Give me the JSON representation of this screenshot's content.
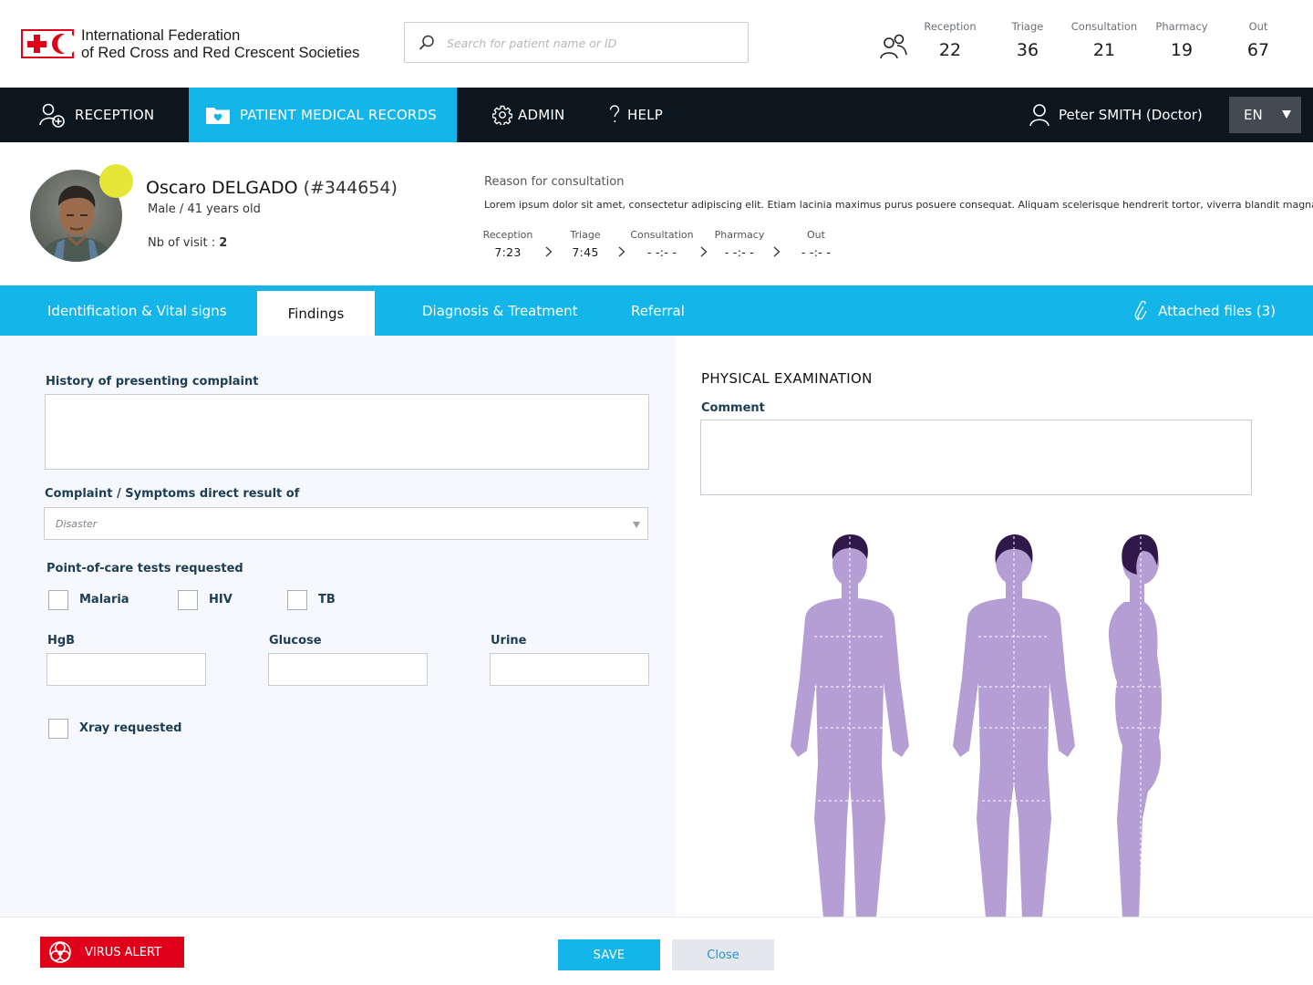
{
  "header": {
    "org_name_line1": "International Federation",
    "org_name_line2": "of Red Cross and Red Crescent Societies",
    "search_placeholder": "Search for patient name or ID",
    "stats": [
      {
        "label": "Reception",
        "value": "22"
      },
      {
        "label": "Triage",
        "value": "36"
      },
      {
        "label": "Consultation",
        "value": "21"
      },
      {
        "label": "Pharmacy",
        "value": "19"
      },
      {
        "label": "Out",
        "value": "67"
      }
    ]
  },
  "nav": {
    "reception": "RECEPTION",
    "patient_records": "PATIENT MEDICAL RECORDS",
    "admin": "ADMIN",
    "help": "HELP",
    "user": "Peter SMITH (Doctor)",
    "language": "EN"
  },
  "patient": {
    "first_name": "Oscaro",
    "last_name": "DELGADO",
    "id": "(#344654)",
    "sex_age": "Male / 41 years old",
    "visits_label": "Nb of visit : ",
    "visits_count": "2",
    "reason_title": "Reason for consultation",
    "reason_text": "Lorem ipsum dolor sit amet, consectetur adipiscing elit. Etiam lacinia maximus purus posuere consequat. Aliquam scelerisque hendrerit tortor, viverra blandit magna.",
    "timeline": [
      {
        "label": "Reception",
        "time": "7:23"
      },
      {
        "label": "Triage",
        "time": "7:45"
      },
      {
        "label": "Consultation",
        "time": "- -:- -"
      },
      {
        "label": "Pharmacy",
        "time": "- -:- -"
      },
      {
        "label": "Out",
        "time": "- -:- -"
      }
    ],
    "status_color": "#e5e637"
  },
  "tabs": {
    "identification": "Identification & Vital signs",
    "findings": "Findings",
    "diagnosis": "Diagnosis & Treatment",
    "referral": "Referral",
    "attached": "Attached files (3)"
  },
  "findings": {
    "history_label": "History of presenting complaint",
    "complaint_label": "Complaint / Symptoms direct result of",
    "complaint_value": "Disaster",
    "poc_label": "Point-of-care tests requested",
    "tests": [
      "Malaria",
      "HIV",
      "TB"
    ],
    "hgb_label": "HgB",
    "glucose_label": "Glucose",
    "urine_label": "Urine",
    "xray_label": "Xray requested"
  },
  "exam": {
    "title": "PHYSICAL EXAMINATION",
    "comment_label": "Comment"
  },
  "footer": {
    "virus_alert": "VIRUS ALERT",
    "save": "SAVE",
    "close": "Close"
  },
  "colors": {
    "accent": "#14b6ea",
    "nav_bg": "#0b161e",
    "alert": "#e1001a",
    "body_figure": "#b59ed3"
  }
}
